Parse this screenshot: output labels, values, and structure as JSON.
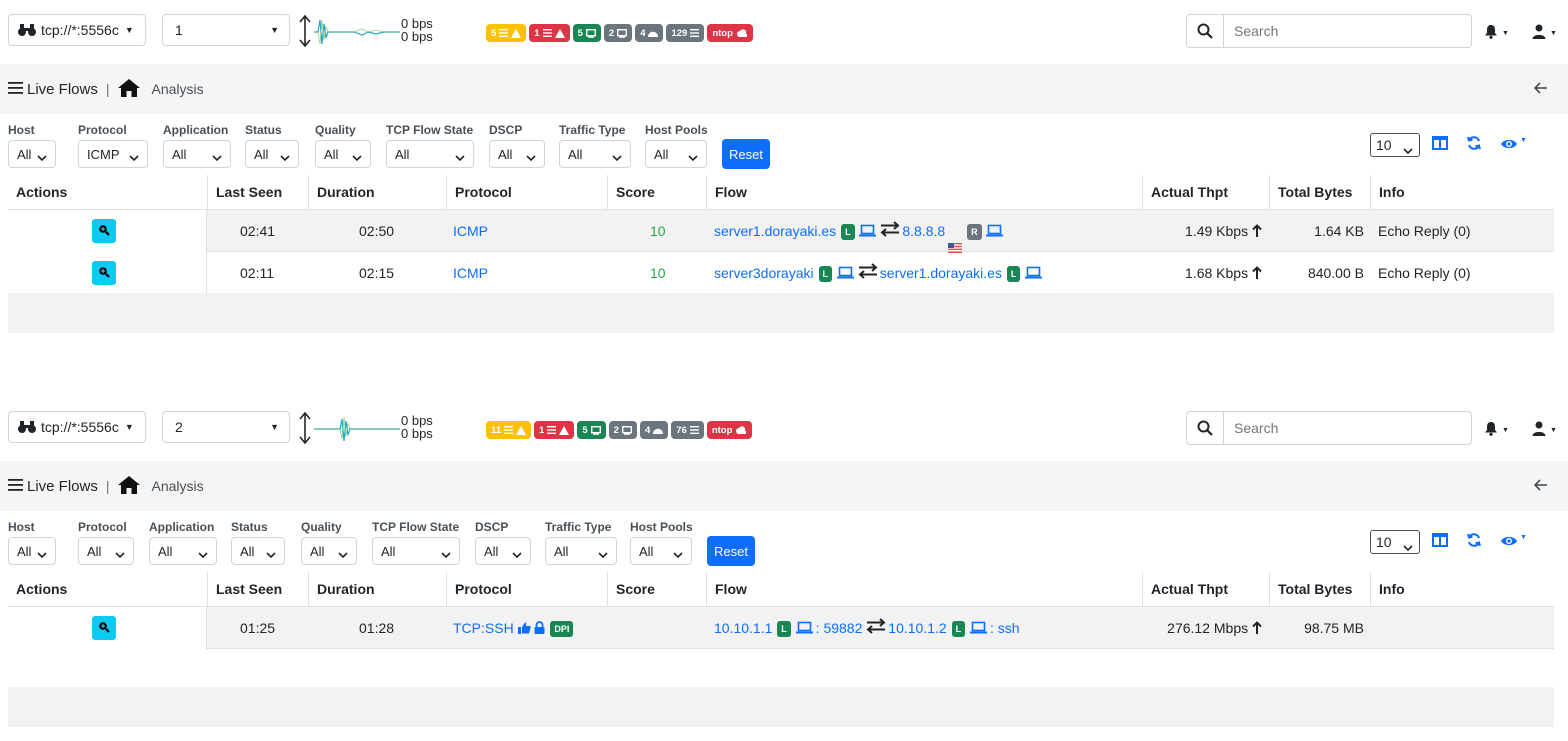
{
  "panels": [
    {
      "interface": "tcp://*:5556c",
      "selector_value": "1",
      "bps_up": "0 bps",
      "bps_down": "0 bps",
      "badges": [
        {
          "label": "5",
          "color": "#ffc107"
        },
        {
          "label": "1",
          "color": "#dc3545"
        },
        {
          "label": "5",
          "color": "#198754"
        },
        {
          "label": "2",
          "color": "#6c757d"
        },
        {
          "label": "4",
          "color": "#6c757d"
        },
        {
          "label": "129",
          "color": "#6c757d"
        },
        {
          "label": "ntop",
          "color": "#dc3545"
        }
      ],
      "search_placeholder": "Search",
      "title": "Live Flows",
      "separator": "|",
      "breadcrumb": "Analysis",
      "filters": [
        {
          "label": "Host",
          "value": "All"
        },
        {
          "label": "Protocol",
          "value": "ICMP"
        },
        {
          "label": "Application",
          "value": "All"
        },
        {
          "label": "Status",
          "value": "All"
        },
        {
          "label": "Quality",
          "value": "All"
        },
        {
          "label": "TCP Flow State",
          "value": "All"
        },
        {
          "label": "DSCP",
          "value": "All"
        },
        {
          "label": "Traffic Type",
          "value": "All"
        },
        {
          "label": "Host Pools",
          "value": "All"
        }
      ],
      "reset_label": "Reset",
      "page_size": "10",
      "columns": [
        "Actions",
        "Last Seen",
        "Duration",
        "Protocol",
        "Score",
        "Flow",
        "Actual Thpt",
        "Total Bytes",
        "Info"
      ],
      "rows": [
        {
          "last_seen": "02:41",
          "duration": "02:50",
          "protocol": "ICMP",
          "score": "10",
          "client": "server1.dorayaki.es",
          "client_badge": "L",
          "client_port": "",
          "server": "8.8.8.8",
          "server_badge": "R",
          "server_port": "",
          "thpt": "1.49 Kbps",
          "bytes": "1.64 KB",
          "info": "Echo Reply (0)"
        },
        {
          "last_seen": "02:11",
          "duration": "02:15",
          "protocol": "ICMP",
          "score": "10",
          "client": "server3dorayaki",
          "client_badge": "L",
          "client_port": "",
          "server": "server1.dorayaki.es",
          "server_badge": "L",
          "server_port": "",
          "thpt": "1.68 Kbps",
          "bytes": "840.00 B",
          "info": "Echo Reply (0)"
        }
      ]
    },
    {
      "interface": "tcp://*:5556c",
      "selector_value": "2",
      "bps_up": "0 bps",
      "bps_down": "0 bps",
      "badges": [
        {
          "label": "11",
          "color": "#ffc107"
        },
        {
          "label": "1",
          "color": "#dc3545"
        },
        {
          "label": "5",
          "color": "#198754"
        },
        {
          "label": "2",
          "color": "#6c757d"
        },
        {
          "label": "4",
          "color": "#6c757d"
        },
        {
          "label": "76",
          "color": "#6c757d"
        },
        {
          "label": "ntop",
          "color": "#dc3545"
        }
      ],
      "search_placeholder": "Search",
      "title": "Live Flows",
      "separator": "|",
      "breadcrumb": "Analysis",
      "filters": [
        {
          "label": "Host",
          "value": "All"
        },
        {
          "label": "Protocol",
          "value": "All"
        },
        {
          "label": "Application",
          "value": "All"
        },
        {
          "label": "Status",
          "value": "All"
        },
        {
          "label": "Quality",
          "value": "All"
        },
        {
          "label": "TCP Flow State",
          "value": "All"
        },
        {
          "label": "DSCP",
          "value": "All"
        },
        {
          "label": "Traffic Type",
          "value": "All"
        },
        {
          "label": "Host Pools",
          "value": "All"
        }
      ],
      "reset_label": "Reset",
      "page_size": "10",
      "columns": [
        "Actions",
        "Last Seen",
        "Duration",
        "Protocol",
        "Score",
        "Flow",
        "Actual Thpt",
        "Total Bytes",
        "Info"
      ],
      "rows": [
        {
          "last_seen": "01:25",
          "duration": "01:28",
          "protocol": "TCP:SSH",
          "protocol_badge": "DPI",
          "score": "",
          "client": "10.10.1.1",
          "client_badge": "L",
          "client_port": ": 59882",
          "server": "10.10.1.2",
          "server_badge": "L",
          "server_port": ": ssh",
          "thpt": "276.12 Mbps",
          "bytes": "98.75 MB",
          "info": ""
        }
      ]
    }
  ]
}
